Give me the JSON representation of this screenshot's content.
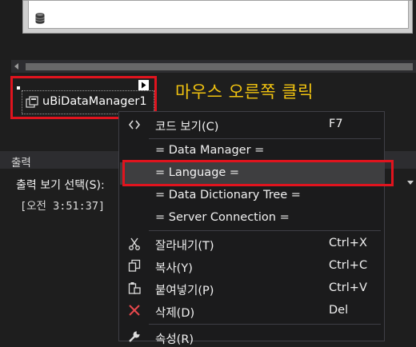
{
  "component": {
    "name": "uBiDataManager1"
  },
  "annotation": {
    "text": "마우스 오른쪽 클릭",
    "color": "#f3c410"
  },
  "output": {
    "title": "출력",
    "select_label": "출력 보기 선택(S):",
    "line": "[오전 3:51:37]"
  },
  "context_menu": {
    "items": [
      {
        "label": "코드 보기(C)",
        "shortcut": "F7",
        "icon": "code-icon"
      },
      {
        "label": "= Data Manager ="
      },
      {
        "label": "= Language =",
        "highlighted": true
      },
      {
        "label": "= Data Dictionary Tree ="
      },
      {
        "label": "= Server Connection ="
      },
      {
        "label": "잘라내기(T)",
        "shortcut": "Ctrl+X",
        "icon": "scissors-icon"
      },
      {
        "label": "복사(Y)",
        "shortcut": "Ctrl+C",
        "icon": "copy-icon"
      },
      {
        "label": "붙여넣기(P)",
        "shortcut": "Ctrl+V",
        "icon": "paste-icon"
      },
      {
        "label": "삭제(D)",
        "shortcut": "Del",
        "icon": "delete-icon"
      },
      {
        "label": "속성(R)",
        "icon": "wrench-icon"
      }
    ]
  },
  "colors": {
    "highlight_box": "#e0141e",
    "menu_bg": "#1b1b1c",
    "hover_bg": "#3e3e40"
  }
}
